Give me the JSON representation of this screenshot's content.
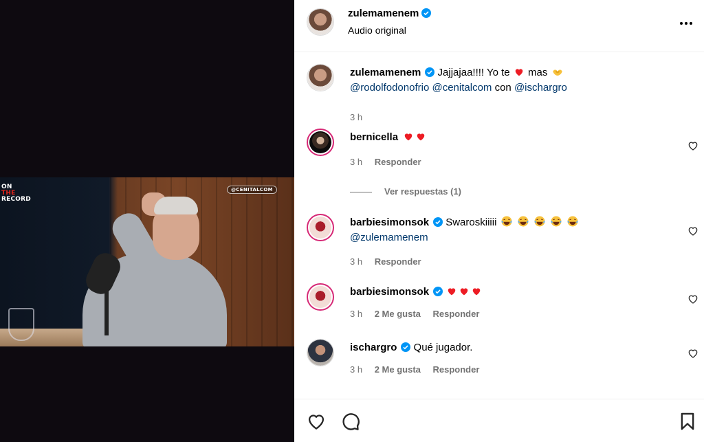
{
  "video": {
    "logo_lines": [
      "ON",
      "THE",
      "RECORD"
    ],
    "watermark": "@CENITALCOM"
  },
  "header": {
    "username": "zulemamenem",
    "subtitle": "Audio original"
  },
  "comments": [
    {
      "username": "zulemamenem",
      "verified": true,
      "text_before_heart": "Jajjajaa!!!! Yo te",
      "text_after_heart": "mas",
      "mentions": [
        "@rodolfodonofrio",
        "@cenitalcom"
      ],
      "connector": "con",
      "mention_last": "@ischargro",
      "time": "3 h"
    },
    {
      "username": "bernicella",
      "time": "3 h",
      "reply": "Responder",
      "view_replies": "Ver respuestas (1)"
    },
    {
      "username": "barbiesimonsok",
      "verified": true,
      "text": "Swaroskiiiii",
      "mention": "@zulemamenem",
      "time": "3 h",
      "reply": "Responder"
    },
    {
      "username": "barbiesimonsok",
      "verified": true,
      "time": "3 h",
      "likes": "2 Me gusta",
      "reply": "Responder"
    },
    {
      "username": "ischargro",
      "verified": true,
      "text": "Qué jugador.",
      "time": "3 h",
      "likes": "2 Me gusta",
      "reply": "Responder"
    }
  ],
  "colors": {
    "verified_blue": "#0095f6",
    "heart_red": "#ed1c24",
    "mention_blue": "#00376b",
    "meta_gray": "#737373"
  },
  "icons": {
    "more": "more-horizontal-icon",
    "like": "heart-outline-icon",
    "comment": "comment-icon",
    "save": "bookmark-icon"
  }
}
